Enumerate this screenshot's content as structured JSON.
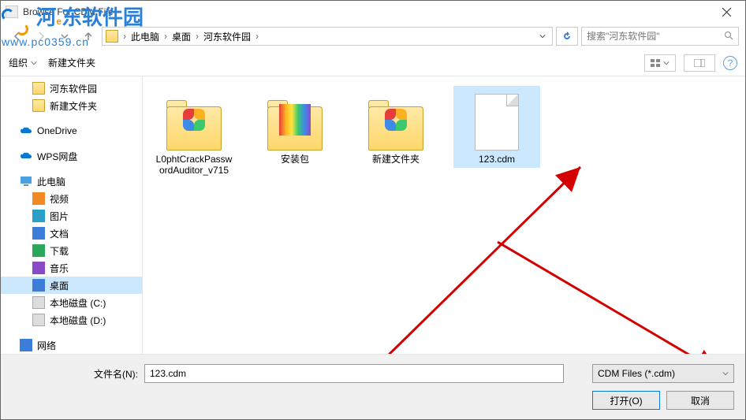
{
  "title": "Browse For CDM File",
  "breadcrumb": {
    "root": "此电脑",
    "part1": "桌面",
    "part2": "河东软件园"
  },
  "search": {
    "placeholder": "搜索\"河东软件园\""
  },
  "toolbar": {
    "organize": "组织",
    "newfolder": "新建文件夹"
  },
  "sidebar": {
    "item0": "河东软件园",
    "item1": "新建文件夹",
    "item2": "OneDrive",
    "item3": "WPS网盘",
    "item4": "此电脑",
    "item5": "视频",
    "item6": "图片",
    "item7": "文档",
    "item8": "下载",
    "item9": "音乐",
    "item10": "桌面",
    "item11": "本地磁盘 (C:)",
    "item12": "本地磁盘 (D:)",
    "item13": "网络"
  },
  "items": {
    "n0": "L0phtCrackPasswordAuditor_v715",
    "n1": "安装包",
    "n2": "新建文件夹",
    "n3": "123.cdm"
  },
  "footer": {
    "filenameLabel": "文件名(N):",
    "filenameValue": "123.cdm",
    "filetype": "CDM Files (*.cdm)",
    "open": "打开(O)",
    "cancel": "取消"
  },
  "watermark": {
    "brand_cn": "河东软件园",
    "brand_e": "e",
    "url": "www.pc0359.cn"
  }
}
